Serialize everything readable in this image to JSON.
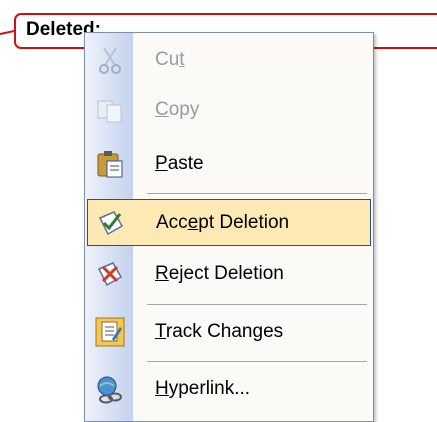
{
  "balloon": {
    "label": "Deleted:"
  },
  "menu": {
    "items": [
      {
        "label_pre": "Cu",
        "label_ul": "t",
        "label_post": "",
        "icon": "scissors-icon",
        "enabled": false
      },
      {
        "label_pre": "",
        "label_ul": "C",
        "label_post": "opy",
        "icon": "copy-icon",
        "enabled": false
      },
      {
        "label_pre": "",
        "label_ul": "P",
        "label_post": "aste",
        "icon": "paste-icon",
        "enabled": true
      },
      {
        "label_pre": "Acc",
        "label_ul": "e",
        "label_post": "pt Deletion",
        "icon": "accept-change-icon",
        "enabled": true,
        "highlighted": true
      },
      {
        "label_pre": "",
        "label_ul": "R",
        "label_post": "eject Deletion",
        "icon": "reject-change-icon",
        "enabled": true
      },
      {
        "label_pre": "",
        "label_ul": "T",
        "label_post": "rack Changes",
        "icon": "track-changes-icon",
        "enabled": true
      },
      {
        "label_pre": "",
        "label_ul": "H",
        "label_post": "yperlink...",
        "icon": "hyperlink-icon",
        "enabled": true
      }
    ]
  },
  "colors": {
    "balloon_border": "#d01010",
    "highlight_fill": "#fde9b4",
    "highlight_border": "#2c4a8e",
    "gutter": "#c4d2ee"
  }
}
